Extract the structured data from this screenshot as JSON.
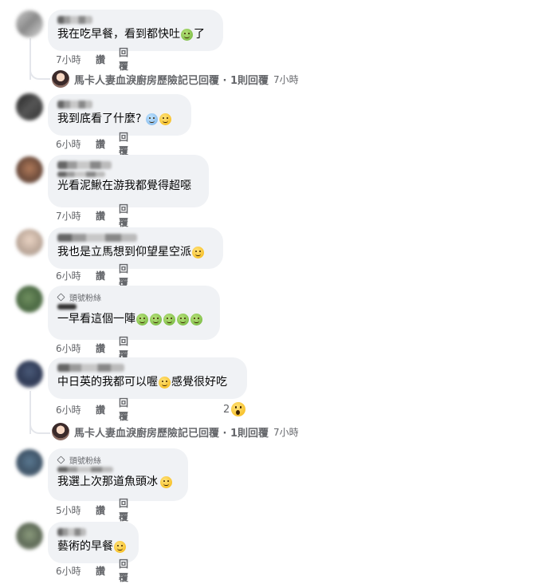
{
  "comments": [
    {
      "text": "我在吃早餐，看到都快吐",
      "suffix": "了",
      "time": "7小時",
      "like": "讚",
      "reply": "回覆"
    },
    {
      "text": "我到底看了什麼?",
      "suffix": "",
      "time": "6小時",
      "like": "讚",
      "reply": "回覆"
    },
    {
      "text": "光看泥鰍在游我都覺得超噁",
      "suffix": "",
      "time": "7小時",
      "like": "讚",
      "reply": "回覆"
    },
    {
      "text": "我也是立馬想到仰望星空派",
      "suffix": "",
      "time": "6小時",
      "like": "讚",
      "reply": "回覆"
    },
    {
      "badge": "頭號粉絲",
      "text": "一早看這個一陣",
      "suffix": "",
      "time": "6小時",
      "like": "讚",
      "reply": "回覆"
    },
    {
      "text": "中日英的我都可以喔",
      "suffix": "感覺很好吃",
      "time": "6小時",
      "like": "讚",
      "reply": "回覆",
      "reactions": "2"
    },
    {
      "badge": "頭號粉絲",
      "text": "我選上次那道魚頭冰",
      "suffix": "",
      "time": "5小時",
      "like": "讚",
      "reply": "回覆"
    },
    {
      "text": "藝術的早餐",
      "suffix": "",
      "time": "6小時",
      "like": "讚",
      "reply": "回覆"
    }
  ],
  "reply_summaries": [
    {
      "label": "馬卡人妻血淚廚房歷險記已回覆 · 1則回覆",
      "time": "7小時"
    },
    {
      "label": "馬卡人妻血淚廚房歷險記已回覆 · 1則回覆",
      "time": "7小時"
    }
  ],
  "emoji_names": [
    "nauseated-face",
    "scream-face",
    "eye-roll-face",
    "laughing-face",
    "relieved-face",
    "wow-reaction"
  ]
}
